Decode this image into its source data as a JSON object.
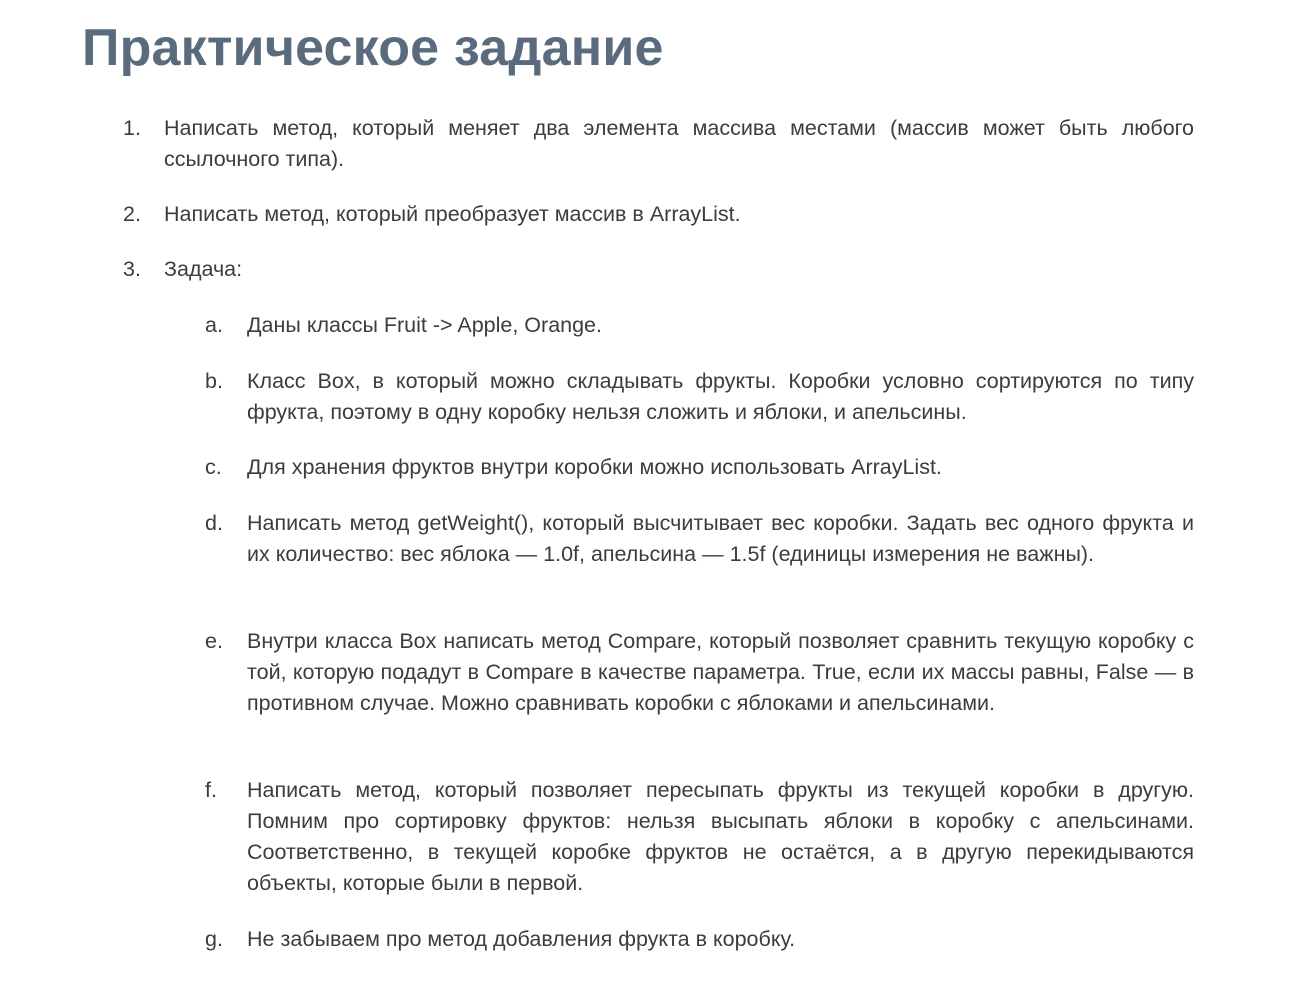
{
  "title": "Практическое задание",
  "tasks": [
    {
      "marker": "1.",
      "text": "Написать метод, который меняет два элемента массива местами (массив может быть любого ссылочного типа)."
    },
    {
      "marker": "2.",
      "text": "Написать метод, который преобразует массив в ArrayList."
    },
    {
      "marker": "3.",
      "text": "Задача:"
    }
  ],
  "subtasks": [
    {
      "marker": "a.",
      "text": "Даны классы Fruit -> Apple, Orange."
    },
    {
      "marker": "b.",
      "text": "Класс Box, в который можно складывать фрукты. Коробки условно сортируются по типу фрукта, поэтому в одну коробку нельзя сложить и яблоки, и апельсины."
    },
    {
      "marker": "c.",
      "text": "Для хранения фруктов внутри коробки можно использовать ArrayList."
    },
    {
      "marker": "d.",
      "text": "Написать метод getWeight(), который высчитывает вес коробки. Задать вес одного фрукта и их количество: вес яблока — 1.0f, апельсина — 1.5f (единицы измерения не важны)."
    },
    {
      "marker": "e.",
      "text": "Внутри класса Box написать метод Compare, который позволяет сравнить текущую коробку с той, которую подадут в Compare в качестве параметра. True, если их массы равны, False — в противном случае. Можно сравнивать коробки с яблоками и апельсинами."
    },
    {
      "marker": "f.",
      "text": "Написать метод, который позволяет пересыпать фрукты из текущей коробки в другую. Помним про сортировку фруктов: нельзя высыпать яблоки в коробку с апельсинами. Соответственно, в текущей коробке фруктов не остаётся, а в другую перекидываются объекты, которые были в первой."
    },
    {
      "marker": "g.",
      "text": "Не забываем про метод добавления фрукта в коробку."
    }
  ]
}
